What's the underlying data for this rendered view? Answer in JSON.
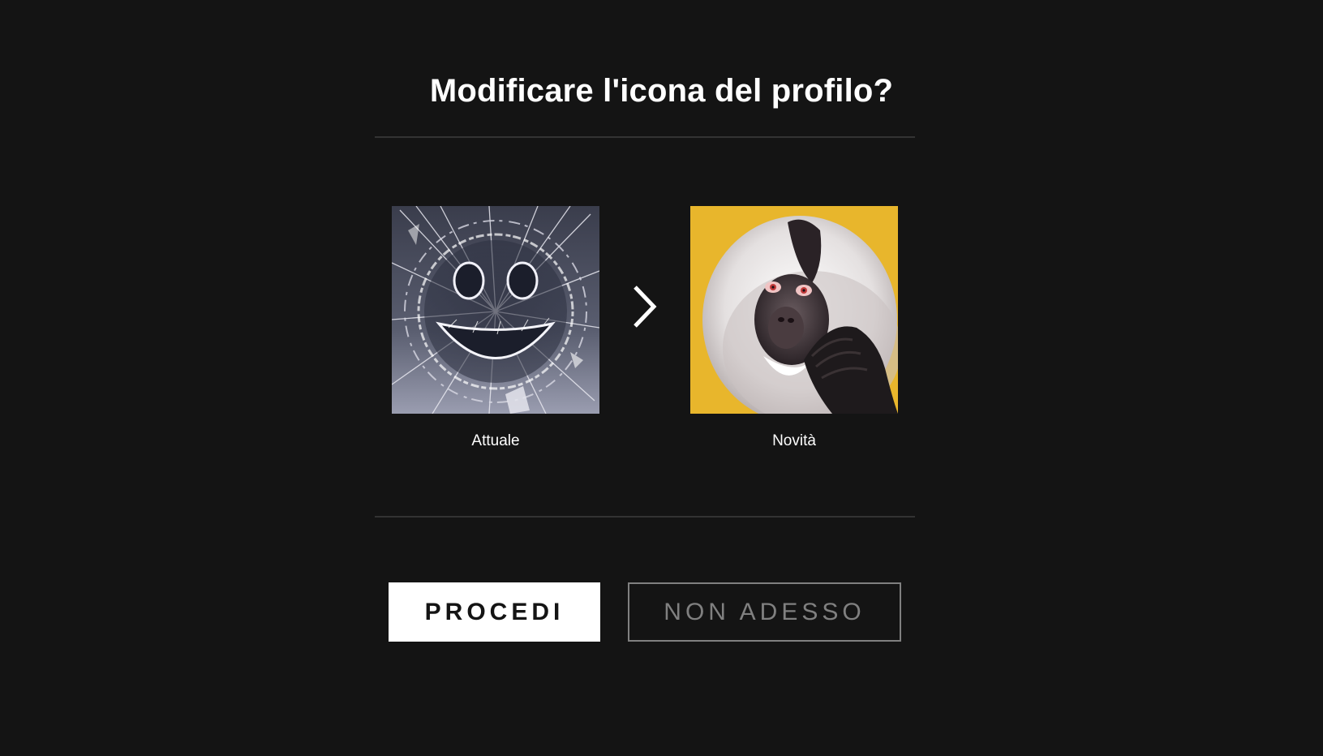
{
  "dialog": {
    "title": "Modificare l'icona del profilo?"
  },
  "avatars": {
    "current": {
      "label": "Attuale",
      "icon": "shattered-glass-smiley-icon"
    },
    "new": {
      "label": "Novità",
      "icon": "monkey-avatar-icon"
    },
    "arrow_icon": "chevron-right-icon"
  },
  "actions": {
    "confirm_label": "PROCEDI",
    "cancel_label": "NON ADESSO"
  },
  "colors": {
    "background": "#141414",
    "divider": "#333333",
    "primary_button_bg": "#ffffff",
    "secondary_button_border": "#808080",
    "new_avatar_bg": "#e8b62c"
  }
}
